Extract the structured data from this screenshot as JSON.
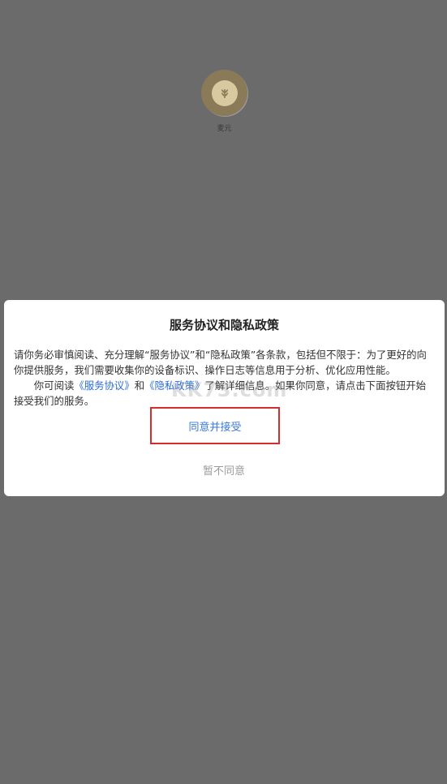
{
  "app": {
    "name": "麦元",
    "logo_icon": "wheat-bag-icon"
  },
  "dialog": {
    "title": "服务协议和隐私政策",
    "paragraph1": "请你务必审慎阅读、充分理解“服务协议”和“隐私政策”各条款，包括但不限于：为了更好的向你提供服务，我们需要收集你的设备标识、操作日志等信息用于分析、优化应用性能。",
    "paragraph2_prefix": "你可阅读",
    "service_link": "《服务协议》",
    "and_text": "和",
    "privacy_link": "《隐私政策》",
    "paragraph2_suffix": "了解详细信息。如果你同意，请点击下面按钮开始接受我们的服务。",
    "agree_label": "同意并接受",
    "disagree_label": "暂不同意"
  },
  "watermark": "KK73.com",
  "colors": {
    "overlay": "#6b6b6b",
    "link": "#2b6bd8",
    "highlight_border": "#d72c2c",
    "disagree_text": "#9a9a9a"
  }
}
